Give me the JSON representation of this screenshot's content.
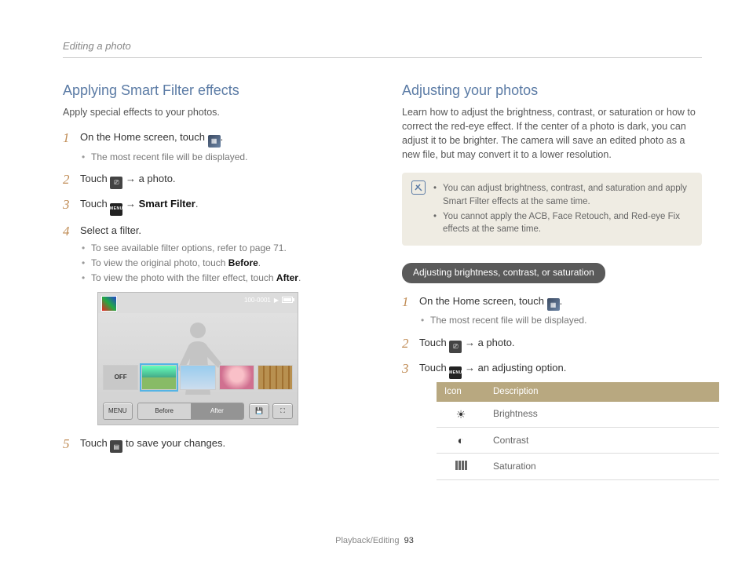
{
  "header": {
    "title": "Editing a photo"
  },
  "left": {
    "heading": "Applying Smart Filter effects",
    "intro": "Apply special effects to your photos.",
    "steps": {
      "s1": {
        "text": "On the Home screen, touch ",
        "bullet": "The most recent file will be displayed."
      },
      "s2": {
        "before": "Touch ",
        "after": " a photo."
      },
      "s3": {
        "before": "Touch ",
        "bold": "Smart Filter",
        "mid": " → "
      },
      "s4": {
        "text": "Select a filter.",
        "b1": "To see available filter options, refer to page 71.",
        "b2_pre": "To view the original photo, touch ",
        "b2_bold": "Before",
        "b3_pre": "To view the photo with the filter effect, touch ",
        "b3_bold": "After"
      },
      "s5": {
        "before": "Touch ",
        "after": " to save your changes."
      }
    },
    "cam": {
      "counter": "100-0001",
      "play_label": "▶",
      "off": "OFF",
      "menu": "MENU",
      "before": "Before",
      "after": "After"
    }
  },
  "right": {
    "heading": "Adjusting your photos",
    "intro": "Learn how to adjust the brightness, contrast, or saturation or how to correct the red-eye effect. If the center of a photo is dark, you can adjust it to be brighter. The camera will save an edited photo as a new file, but may convert it to a lower resolution.",
    "note": {
      "n1": "You can adjust brightness, contrast, and saturation and apply Smart Filter effects at the same time.",
      "n2": "You cannot apply the ACB, Face Retouch, and Red-eye Fix effects at the same time."
    },
    "pill": "Adjusting brightness, contrast, or saturation",
    "steps": {
      "s1": {
        "text": "On the Home screen, touch ",
        "bullet": "The most recent file will be displayed."
      },
      "s2": {
        "before": "Touch ",
        "after": " a photo."
      },
      "s3": {
        "before": "Touch ",
        "after": " an adjusting option."
      }
    },
    "table": {
      "h1": "Icon",
      "h2": "Description",
      "r1": "Brightness",
      "r2": "Contrast",
      "r3": "Saturation"
    }
  },
  "icons": {
    "menu_label": "MENU",
    "arrow": "→"
  },
  "footer": {
    "section": "Playback/Editing",
    "page": "93"
  }
}
